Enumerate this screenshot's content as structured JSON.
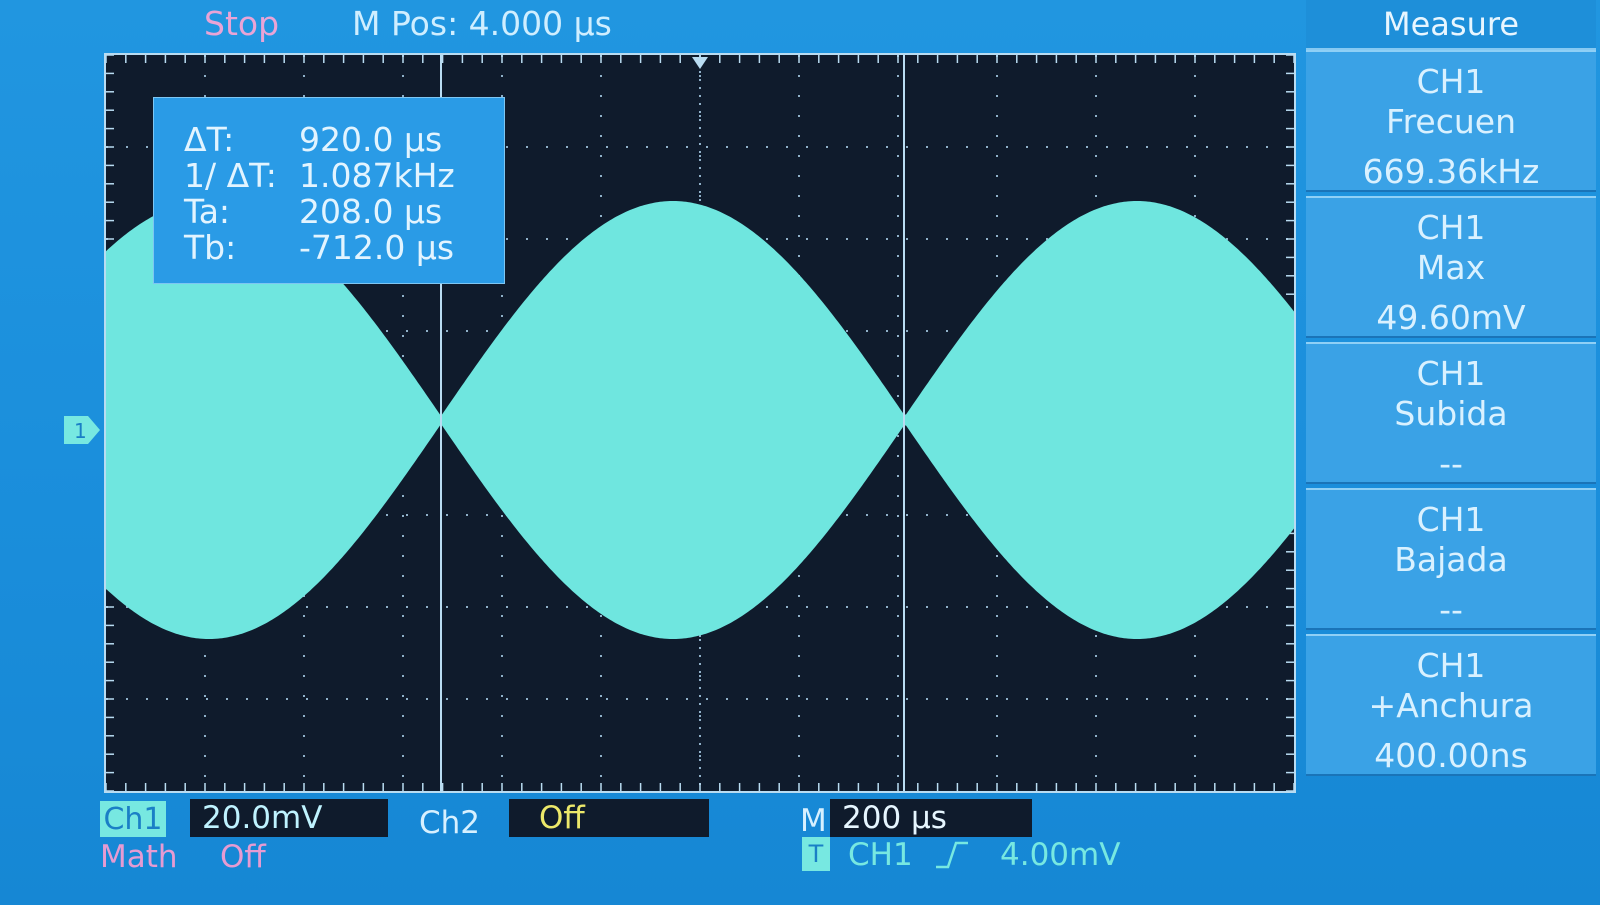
{
  "status": {
    "run_state": "Stop",
    "m_pos": "M Pos: 4.000 µs"
  },
  "channel_marker": "1",
  "cursor_readout": {
    "delta_t_label": "ΔT:",
    "delta_t_value": "920.0 µs",
    "inv_delta_t_label": "1/ ΔT:",
    "inv_delta_t_value": "1.087kHz",
    "ta_label": "Ta:",
    "ta_value": "208.0 µs",
    "tb_label": "Tb:",
    "tb_value": "-712.0 µs"
  },
  "menu": {
    "title": "Measure",
    "items": [
      {
        "source": "CH1",
        "type": "Frecuen",
        "value": "669.36kHz"
      },
      {
        "source": "CH1",
        "type": "Max",
        "value": "49.60mV"
      },
      {
        "source": "CH1",
        "type": "Subida",
        "value": "--"
      },
      {
        "source": "CH1",
        "type": "Bajada",
        "value": "--"
      },
      {
        "source": "CH1",
        "type": "+Anchura",
        "value": "400.00ns"
      }
    ]
  },
  "bottom": {
    "ch1_label": "Ch1",
    "ch1_scale": "20.0mV",
    "ch2_label": "Ch2",
    "ch2_scale": "Off",
    "m_label": "M",
    "timebase": "200 µs",
    "math_label": "Math",
    "math_value": "Off",
    "trigger_tag": "T",
    "trigger_source": "CH1",
    "trigger_level": "4.00mV"
  },
  "colors": {
    "background": "#1b8fdc",
    "grid_bg": "#0f1b2c",
    "trace": "#6fe6df",
    "menu_item": "#3aa2e6",
    "math_text": "#e69bd2",
    "ch2_text": "#ece86a"
  }
}
